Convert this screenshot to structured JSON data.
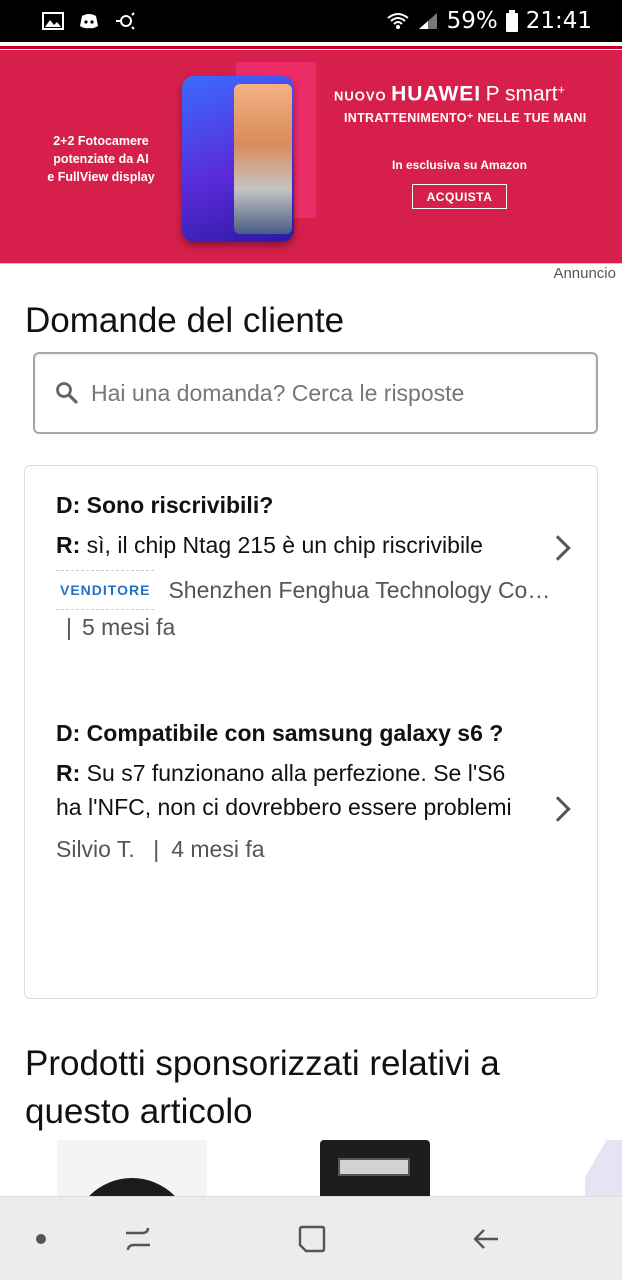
{
  "status_bar": {
    "battery": "59%",
    "time": "21:41"
  },
  "ad": {
    "left_text": [
      "2+2 Fotocamere",
      "potenziate da AI",
      "e FullView display"
    ],
    "nuovo": "NUOVO",
    "brand": "HUAWEI",
    "model": "P smart",
    "plus": "+",
    "tagline": "INTRATTENIMENTO⁺ NELLE TUE MANI",
    "exclusive": "In esclusiva su Amazon",
    "button": "ACQUISTA",
    "sponsor_label": "Annuncio",
    "accent_color": "#d6204b"
  },
  "questions": {
    "title": "Domande del cliente",
    "search_placeholder": "Hai una domanda? Cerca le risposte",
    "items": [
      {
        "question": "D: Sono riscrivibili?",
        "answer_prefix": "R:",
        "answer": " sì, il chip Ntag 215 è un chip riscrivibile",
        "badge": "VENDITORE",
        "author": "Shenzhen Fenghua Technology Co…",
        "separator": "|",
        "time": "5 mesi fa"
      },
      {
        "question": "D: Compatibile con samsung galaxy s6 ?",
        "answer_prefix": "R:",
        "answer": " Su s7 funzionano alla perfezione. Se l'S6 ha l'NFC, non ci dovrebbero essere problemi",
        "author": "Silvio T.",
        "separator": "|",
        "time": "4 mesi fa"
      }
    ]
  },
  "sponsored": {
    "title": "Prodotti sponsorizzati relativi a questo articolo"
  },
  "icons": [
    "image-icon",
    "discord-icon",
    "bluetooth-icon",
    "wifi-icon",
    "signal-icon",
    "battery-icon",
    "search-icon",
    "chevron-right-icon",
    "recent-apps-icon",
    "home-icon",
    "back-icon"
  ]
}
